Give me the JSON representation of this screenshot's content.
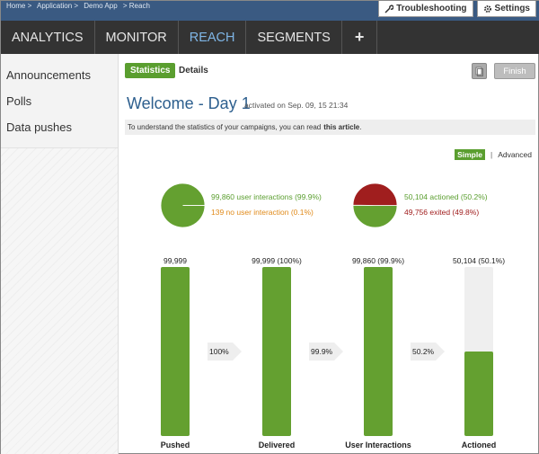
{
  "breadcrumbs": [
    "Home >",
    "Application >",
    "Demo App",
    "> Reach"
  ],
  "top_tabs": [
    {
      "label": "Troubleshooting",
      "icon": "wrench-icon"
    },
    {
      "label": "Settings",
      "icon": "gear-icon"
    }
  ],
  "nav": [
    "ANALYTICS",
    "MONITOR",
    "REACH",
    "SEGMENTS",
    "+"
  ],
  "sidebar": [
    "Announcements",
    "Polls",
    "Data pushes"
  ],
  "subtabs": [
    "Statistics",
    "Details"
  ],
  "finish_label": "Finish",
  "title": "Welcome - Day 1",
  "activated": "activated on Sep. 09, 15 21:34",
  "info": {
    "text": "To understand the statistics of your campaigns, you can read",
    "link": "this article",
    "end": "."
  },
  "mode": {
    "simple": "Simple",
    "sep": "|",
    "advanced": "Advanced"
  },
  "pie1": {
    "green_text": "99,860 user interactions (99.9%)",
    "orange_text": "139 no user interaction (0.1%)",
    "green_pct": 99.9,
    "colors": {
      "green": "#64a030",
      "orange": "#e08a1a"
    }
  },
  "pie2": {
    "green_text": "50,104 actioned (50.2%)",
    "red_text": "49,756 exited (49.8%)",
    "green_pct": 50.2,
    "colors": {
      "green": "#64a030",
      "red": "#a01e1e"
    }
  },
  "funnel": [
    {
      "value_text": "99,999",
      "label": "Pushed",
      "pct": 100
    },
    {
      "value_text": "99,999 (100%)",
      "label": "Delivered",
      "pct": 100
    },
    {
      "value_text": "99,860 (99.9%)",
      "label": "User Interactions",
      "pct": 99.9
    },
    {
      "value_text": "50,104 (50.1%)",
      "label": "Actioned",
      "pct": 50.1
    }
  ],
  "arrows": [
    "100%",
    "99.9%",
    "50.2%"
  ]
}
